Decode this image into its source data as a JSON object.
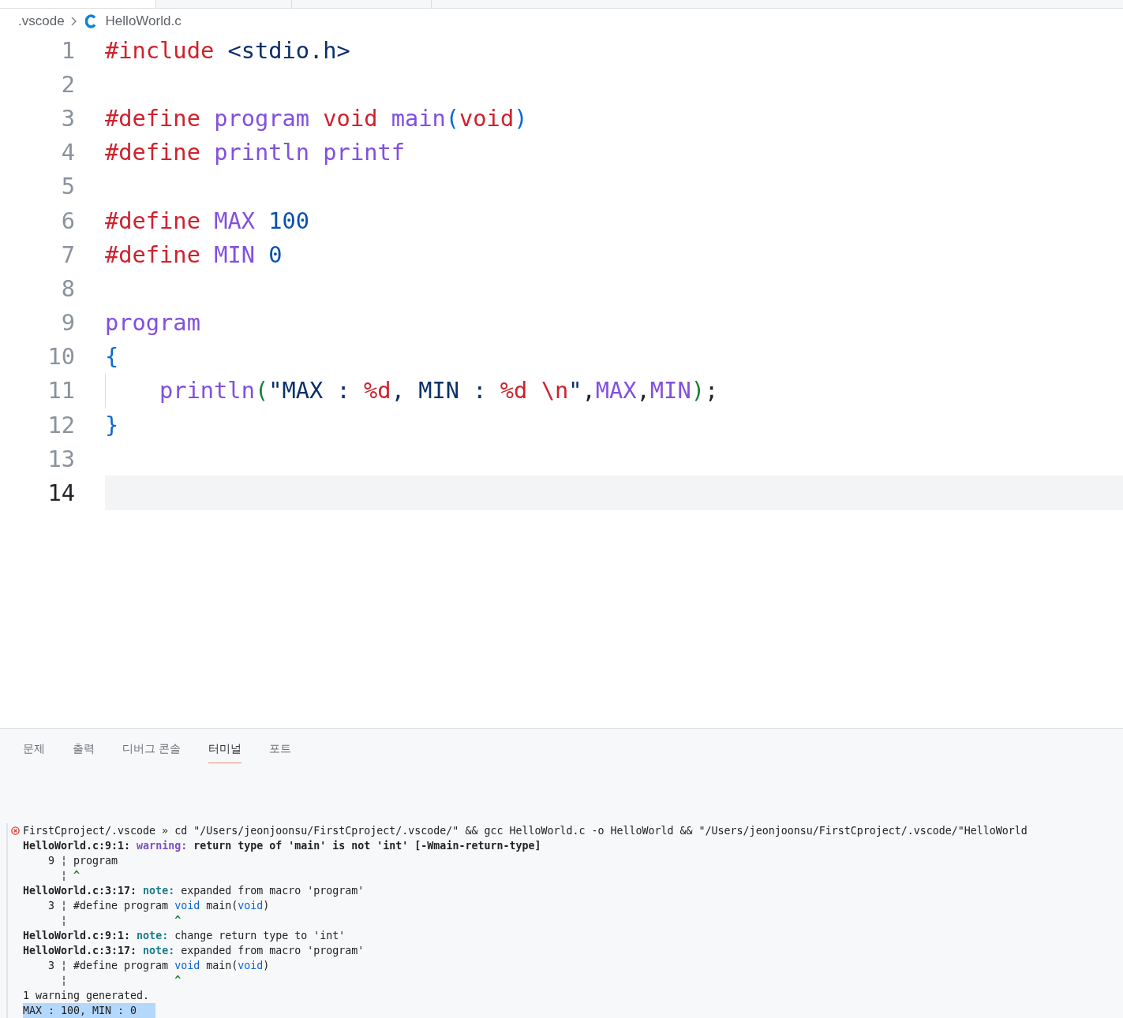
{
  "breadcrumb": {
    "items": [
      {
        "label": ".vscode",
        "kind": "folder"
      },
      {
        "label": "HelloWorld.c",
        "kind": "c-file"
      }
    ]
  },
  "editor": {
    "lines": [
      {
        "number": "1",
        "current": false,
        "indented": false,
        "tokens": [
          {
            "text": "#include",
            "kind": "directive"
          },
          {
            "text": " <stdio.h>",
            "kind": "header"
          }
        ]
      },
      {
        "number": "2",
        "current": false,
        "indented": false
      },
      {
        "number": "3",
        "current": false,
        "indented": false,
        "tokens": [
          {
            "text": "#define",
            "kind": "directive"
          },
          {
            "text": " program",
            "kind": "macro"
          },
          {
            "text": " void",
            "kind": "keyword"
          },
          {
            "text": " main",
            "kind": "macro"
          },
          {
            "text": "(",
            "kind": "bracket"
          },
          {
            "text": "void",
            "kind": "keyword"
          },
          {
            "text": ")",
            "kind": "bracket"
          }
        ]
      },
      {
        "number": "4",
        "current": false,
        "indented": false,
        "tokens": [
          {
            "text": "#define",
            "kind": "directive"
          },
          {
            "text": " println",
            "kind": "macro"
          },
          {
            "text": " printf",
            "kind": "macro"
          }
        ]
      },
      {
        "number": "5",
        "current": false,
        "indented": false
      },
      {
        "number": "6",
        "current": false,
        "indented": false,
        "tokens": [
          {
            "text": "#define",
            "kind": "directive"
          },
          {
            "text": " MAX",
            "kind": "macro"
          },
          {
            "text": " 100",
            "kind": "number"
          }
        ]
      },
      {
        "number": "7",
        "current": false,
        "indented": false,
        "tokens": [
          {
            "text": "#define",
            "kind": "directive"
          },
          {
            "text": " MIN",
            "kind": "macro"
          },
          {
            "text": " 0",
            "kind": "number"
          }
        ]
      },
      {
        "number": "8",
        "current": false,
        "indented": false
      },
      {
        "number": "9",
        "current": false,
        "indented": false,
        "tokens": [
          {
            "text": "program",
            "kind": "macro"
          }
        ]
      },
      {
        "number": "10",
        "current": false,
        "indented": false,
        "tokens": [
          {
            "text": "{",
            "kind": "bracket"
          }
        ]
      },
      {
        "number": "11",
        "current": false,
        "indented": true,
        "tokens": [
          {
            "text": "println",
            "kind": "macro"
          },
          {
            "text": "(",
            "kind": "bracket2"
          },
          {
            "text": "\"MAX : ",
            "kind": "string"
          },
          {
            "text": "%d",
            "kind": "escape"
          },
          {
            "text": ", MIN : ",
            "kind": "string"
          },
          {
            "text": "%d \\n",
            "kind": "escape"
          },
          {
            "text": "\"",
            "kind": "string"
          },
          {
            "text": ",",
            "kind": "punct"
          },
          {
            "text": "MAX",
            "kind": "macro"
          },
          {
            "text": ",",
            "kind": "punct"
          },
          {
            "text": "MIN",
            "kind": "macro"
          },
          {
            "text": ")",
            "kind": "bracket2"
          },
          {
            "text": ";",
            "kind": "punct"
          }
        ]
      },
      {
        "number": "12",
        "current": false,
        "indented": false,
        "tokens": [
          {
            "text": "}",
            "kind": "bracket"
          }
        ]
      },
      {
        "number": "13",
        "current": false,
        "indented": false
      },
      {
        "number": "14",
        "current": true,
        "indented": false
      }
    ]
  },
  "panel": {
    "tabs": [
      {
        "label": "문제",
        "selected": false
      },
      {
        "label": "출력",
        "selected": false
      },
      {
        "label": "디버그 콘솔",
        "selected": false
      },
      {
        "label": "터미널",
        "selected": true
      },
      {
        "label": "포트",
        "selected": false
      }
    ],
    "terminal": {
      "lines": [
        {
          "kind": "failed-command",
          "highlighted": false,
          "segments": [
            {
              "text": "FirstCproject/.vscode » cd \"/Users/jeonjoonsu/FirstCproject/.vscode/\" && gcc HelloWorld.c -o HelloWorld && \"/Users/jeonjoonsu/FirstCproject/.vscode/\"HelloWorld",
              "kind": "plain"
            }
          ]
        },
        {
          "kind": "output",
          "highlighted": false,
          "segments": [
            {
              "text": "HelloWorld.c:9:1: ",
              "kind": "bold"
            },
            {
              "text": "warning:",
              "kind": "warning"
            },
            {
              "text": " return type of 'main' is not 'int' [-Wmain-return-type]",
              "kind": "bold"
            }
          ]
        },
        {
          "kind": "output",
          "highlighted": false,
          "segments": [
            {
              "text": "    9 ¦ program",
              "kind": "plain"
            }
          ]
        },
        {
          "kind": "output",
          "highlighted": false,
          "segments": [
            {
              "text": "      ¦ ",
              "kind": "plain"
            },
            {
              "text": "^",
              "kind": "caret"
            }
          ]
        },
        {
          "kind": "output",
          "highlighted": false,
          "segments": [
            {
              "text": "HelloWorld.c:3:17: ",
              "kind": "bold"
            },
            {
              "text": "note:",
              "kind": "note"
            },
            {
              "text": " expanded from macro 'program'",
              "kind": "plain"
            }
          ]
        },
        {
          "kind": "output",
          "highlighted": false,
          "segments": [
            {
              "text": "    3 ¦ #define program ",
              "kind": "plain"
            },
            {
              "text": "void",
              "kind": "keyword"
            },
            {
              "text": " main(",
              "kind": "plain"
            },
            {
              "text": "void",
              "kind": "keyword"
            },
            {
              "text": ")",
              "kind": "plain"
            }
          ]
        },
        {
          "kind": "output",
          "highlighted": false,
          "segments": [
            {
              "text": "      ¦                 ",
              "kind": "plain"
            },
            {
              "text": "^",
              "kind": "caret"
            }
          ]
        },
        {
          "kind": "output",
          "highlighted": false,
          "segments": [
            {
              "text": "HelloWorld.c:9:1: ",
              "kind": "bold"
            },
            {
              "text": "note:",
              "kind": "note"
            },
            {
              "text": " change return type to 'int'",
              "kind": "plain"
            }
          ]
        },
        {
          "kind": "output",
          "highlighted": false,
          "segments": [
            {
              "text": "HelloWorld.c:3:17: ",
              "kind": "bold"
            },
            {
              "text": "note:",
              "kind": "note"
            },
            {
              "text": " expanded from macro 'program'",
              "kind": "plain"
            }
          ]
        },
        {
          "kind": "output",
          "highlighted": false,
          "segments": [
            {
              "text": "    3 ¦ #define program ",
              "kind": "plain"
            },
            {
              "text": "void",
              "kind": "keyword"
            },
            {
              "text": " main(",
              "kind": "plain"
            },
            {
              "text": "void",
              "kind": "keyword"
            },
            {
              "text": ")",
              "kind": "plain"
            }
          ]
        },
        {
          "kind": "output",
          "highlighted": false,
          "segments": [
            {
              "text": "      ¦                 ",
              "kind": "plain"
            },
            {
              "text": "^",
              "kind": "caret"
            }
          ]
        },
        {
          "kind": "output",
          "highlighted": false,
          "segments": [
            {
              "text": "1 warning generated.",
              "kind": "plain"
            }
          ]
        },
        {
          "kind": "output",
          "highlighted": true,
          "segments": [
            {
              "text": "MAX : 100, MIN : 0",
              "kind": "plain"
            }
          ]
        }
      ]
    }
  }
}
